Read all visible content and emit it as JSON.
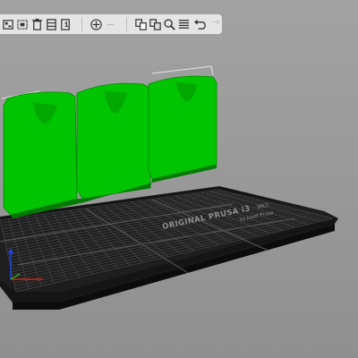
{
  "toolbar": {
    "buttons": [
      {
        "name": "add-button",
        "icon": "add-icon"
      },
      {
        "name": "delete-button",
        "icon": "delete-icon"
      },
      {
        "name": "delete-all-button",
        "icon": "delete-all-icon"
      },
      {
        "name": "arrange-button",
        "icon": "arrange-icon"
      },
      {
        "name": "copy-button",
        "icon": "copy-icon"
      },
      {
        "name": "paste-button",
        "icon": "paste-icon"
      },
      {
        "name": "add-instance-button",
        "icon": "plus-icon"
      },
      {
        "name": "remove-instance-button",
        "icon": "minus-icon"
      },
      {
        "name": "split-objects-button",
        "icon": "split-objects-icon"
      },
      {
        "name": "split-parts-button",
        "icon": "split-parts-icon"
      },
      {
        "name": "search-button",
        "icon": "search-icon"
      },
      {
        "name": "layers-button",
        "icon": "layers-icon"
      },
      {
        "name": "undo-button",
        "icon": "undo-icon"
      },
      {
        "name": "redo-button",
        "icon": "redo-icon"
      }
    ]
  },
  "bed": {
    "label_line1": "ORIGINAL PRUSA i3",
    "label_model": "MK3",
    "label_line2": "by Josef Prusa"
  },
  "colors": {
    "object": "#00c400",
    "object_shadow": "#009400",
    "bed_surface": "#1e1e1e",
    "grid": "#4a4a4a",
    "background": "#9a9a9a",
    "axis_x": "#cc2222",
    "axis_y": "#22aa22",
    "axis_z": "#2244dd"
  }
}
